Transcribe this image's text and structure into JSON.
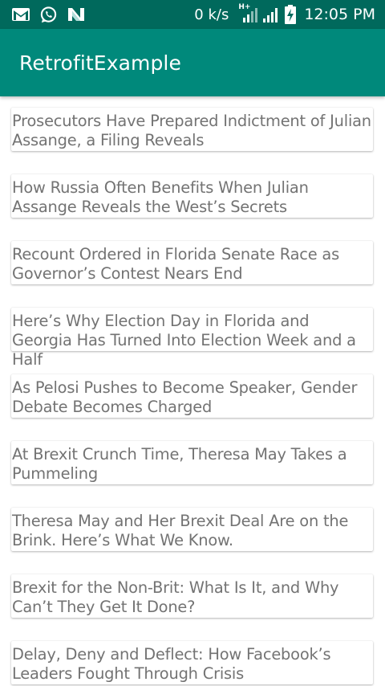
{
  "status_bar": {
    "icons": [
      "gmail-icon",
      "whatsapp-icon",
      "n-notification-icon",
      "hplus-signal-icon",
      "cell-signal-icon",
      "battery-charging-icon"
    ],
    "network_speed": "0 k/s",
    "network_type": "H+",
    "time": "12:05 PM"
  },
  "app_bar": {
    "title": "RetrofitExample"
  },
  "articles": [
    {
      "title": "Prosecutors Have Prepared Indictment of Julian Assange, a Filing Reveals"
    },
    {
      "title": "How Russia Often Benefits When Julian Assange Reveals the West’s Secrets"
    },
    {
      "title": "Recount Ordered in Florida Senate Race as Governor’s Contest Nears End"
    },
    {
      "title": "Here’s Why Election Day in Florida and Georgia Has Turned Into Election Week and a Half"
    },
    {
      "title": "As Pelosi Pushes to Become Speaker, Gender Debate Becomes Charged"
    },
    {
      "title": "At Brexit Crunch Time, Theresa May Takes a Pummeling"
    },
    {
      "title": "Theresa May and Her Brexit Deal Are on the Brink. Here’s What We Know."
    },
    {
      "title": "Brexit for the Non-Brit: What Is It, and Why Can’t They Get It Done?"
    },
    {
      "title": "Delay, Deny and Deflect: How Facebook’s Leaders Fought Through Crisis"
    }
  ],
  "colors": {
    "status_bar": "#00695c",
    "app_bar": "#00897b",
    "card_text": "#737373"
  }
}
